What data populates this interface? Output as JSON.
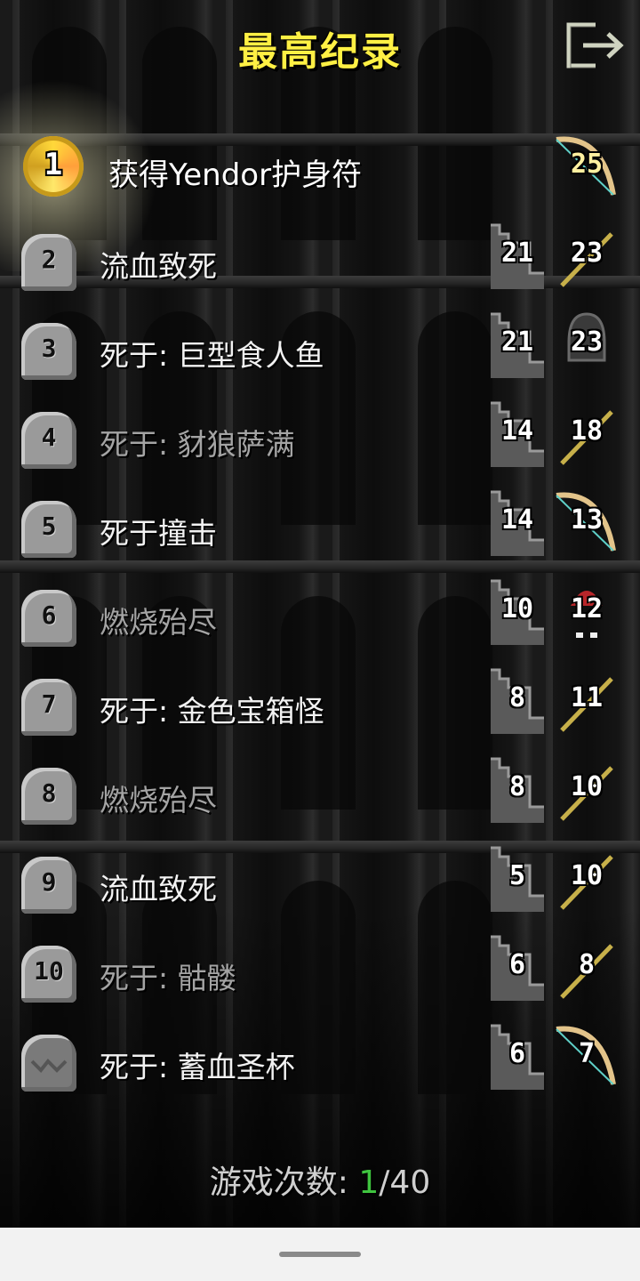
{
  "title": "最高纪录",
  "icons": {
    "exit": "exit-icon",
    "medal": "amulet-medal-icon",
    "depth": "depth-stairs-icon",
    "grave": "gravestone-icon",
    "bow": "bow-icon",
    "staff": "staff-icon",
    "helmet": "helmet-icon",
    "mage_hat": "mage-hat-icon"
  },
  "records": [
    {
      "rank": "1",
      "cause": "获得Yendor护身符",
      "depth": "",
      "level": "25",
      "class_icon": "bow",
      "status": "win"
    },
    {
      "rank": "2",
      "cause": "流血致死",
      "depth": "21",
      "level": "23",
      "class_icon": "staff",
      "status": "dead"
    },
    {
      "rank": "3",
      "cause": "死于: 巨型食人鱼",
      "depth": "21",
      "level": "23",
      "class_icon": "helmet",
      "status": "dead"
    },
    {
      "rank": "4",
      "cause": "死于: 豺狼萨满",
      "depth": "14",
      "level": "18",
      "class_icon": "staff",
      "status": "dead"
    },
    {
      "rank": "5",
      "cause": "死于撞击",
      "depth": "14",
      "level": "13",
      "class_icon": "bow",
      "status": "dead"
    },
    {
      "rank": "6",
      "cause": "燃烧殆尽",
      "depth": "10",
      "level": "12",
      "class_icon": "mage_hat",
      "status": "dead"
    },
    {
      "rank": "7",
      "cause": "死于: 金色宝箱怪",
      "depth": "8",
      "level": "11",
      "class_icon": "staff",
      "status": "dead"
    },
    {
      "rank": "8",
      "cause": "燃烧殆尽",
      "depth": "8",
      "level": "10",
      "class_icon": "staff",
      "status": "dead"
    },
    {
      "rank": "9",
      "cause": "流血致死",
      "depth": "5",
      "level": "10",
      "class_icon": "staff",
      "status": "dead"
    },
    {
      "rank": "10",
      "cause": "死于: 骷髅",
      "depth": "6",
      "level": "8",
      "class_icon": "staff",
      "status": "dead"
    },
    {
      "rank": "",
      "cause": "死于: 蓄血圣杯",
      "depth": "6",
      "level": "7",
      "class_icon": "bow",
      "status": "dead"
    }
  ],
  "footer": {
    "label": "游戏次数:",
    "count": "1",
    "total": "/40"
  },
  "colors": {
    "title": "#fff044",
    "count": "#3fc43f",
    "text": "#f2f2f2",
    "dim_text": "#a4a4a4"
  }
}
